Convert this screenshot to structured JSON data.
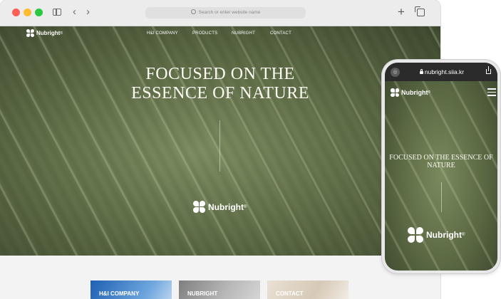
{
  "browser": {
    "address_placeholder": "Search or enter website name",
    "icons": [
      "sidebar-toggle-icon",
      "back-arrow-icon",
      "forward-arrow-icon",
      "search-icon",
      "new-tab-plus-icon",
      "tabs-overview-icon"
    ]
  },
  "site": {
    "logo": "Nubright",
    "logo_mark": "®",
    "nav": [
      "H&I COMPANY",
      "PRODUCTS",
      "NUBRIGHT",
      "CONTACT"
    ],
    "hero_title_line1": "FOCUSED ON THE",
    "hero_title_line2": "ESSENCE OF NATURE",
    "cards": [
      "H&I COMPANY",
      "NUBRIGHT",
      "CONTACT"
    ]
  },
  "phone": {
    "url": "nubright.siia.kr",
    "hero_title": "FOCUSED ON THE ESSENCE OF NATURE"
  },
  "colors": {
    "traffic_red": "#ff5f57",
    "traffic_yellow": "#febc2e",
    "traffic_green": "#28c840",
    "leaf_green": "#62714a"
  }
}
